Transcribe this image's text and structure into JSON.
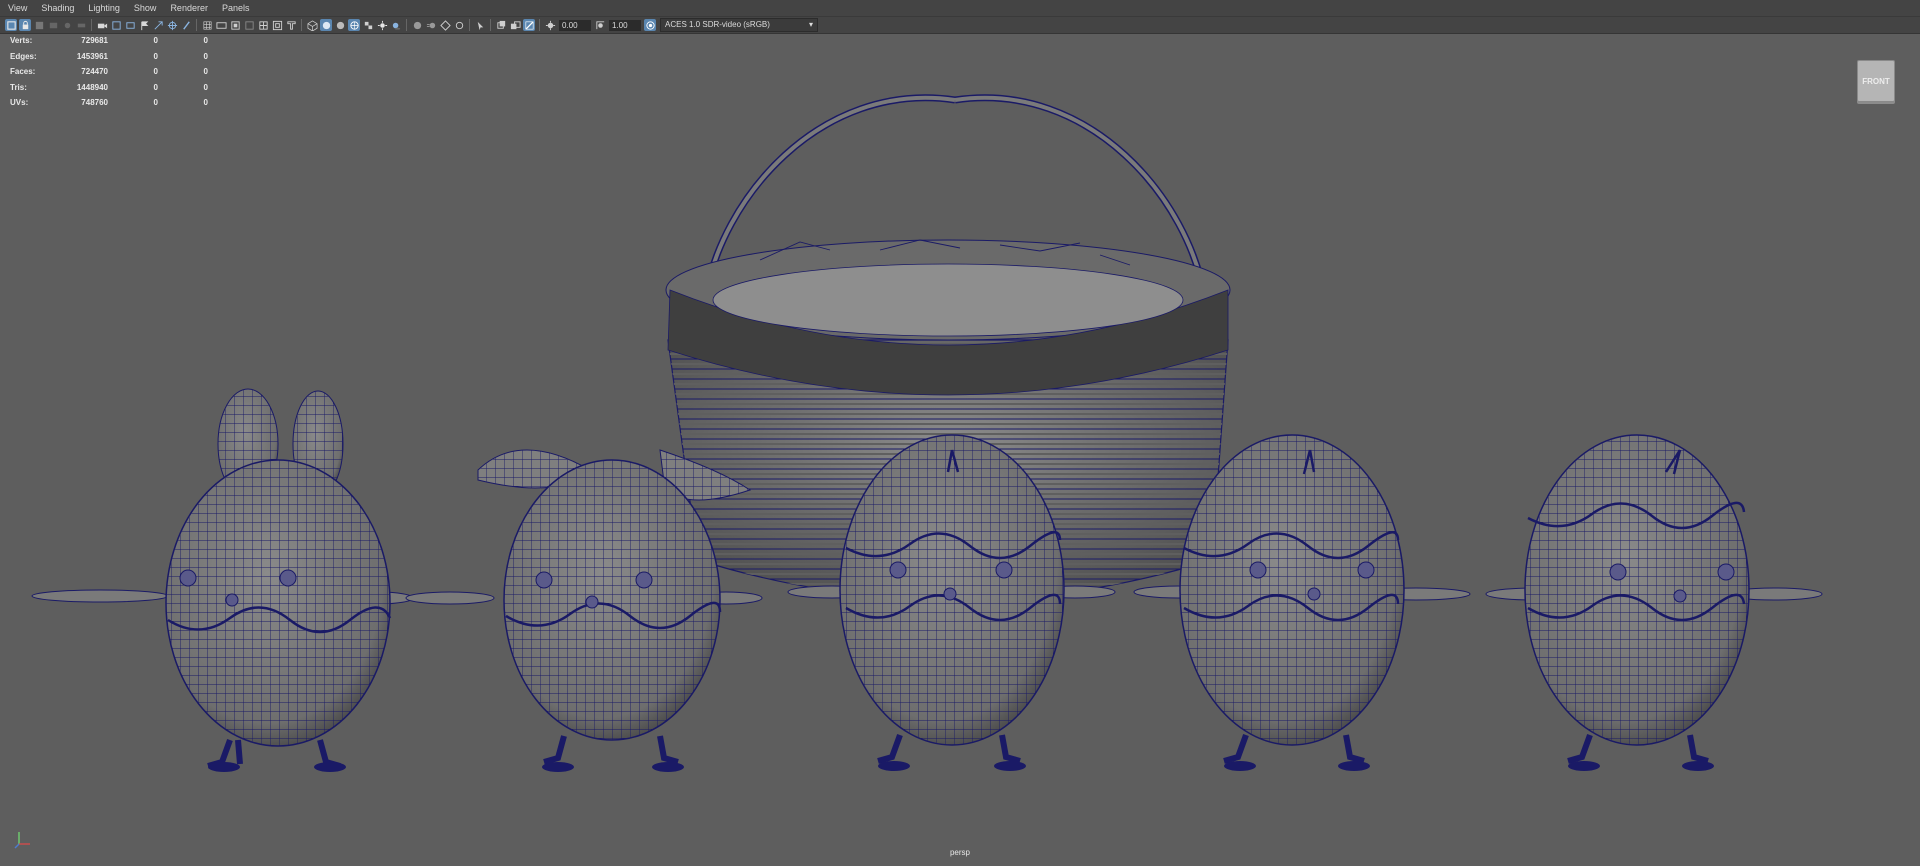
{
  "menu": [
    "View",
    "Shading",
    "Lighting",
    "Show",
    "Renderer",
    "Panels"
  ],
  "toolbar": {
    "exposure": "0.00",
    "gamma": "1.00",
    "color_space": "ACES 1.0 SDR-video (sRGB)"
  },
  "hud": {
    "rows": [
      {
        "label": "Verts:",
        "value": "729681",
        "c1": "0",
        "c2": "0"
      },
      {
        "label": "Edges:",
        "value": "1453961",
        "c1": "0",
        "c2": "0"
      },
      {
        "label": "Faces:",
        "value": "724470",
        "c1": "0",
        "c2": "0"
      },
      {
        "label": "Tris:",
        "value": "1448940",
        "c1": "0",
        "c2": "0"
      },
      {
        "label": "UVs:",
        "value": "748760",
        "c1": "0",
        "c2": "0"
      }
    ]
  },
  "viewcube": {
    "face": "FRONT"
  },
  "camera": {
    "name": "persp"
  },
  "colors": {
    "wire": "#1a1a66",
    "mesh": "#808080",
    "background": "#5e5e5e",
    "accent": "#5a86b0"
  }
}
